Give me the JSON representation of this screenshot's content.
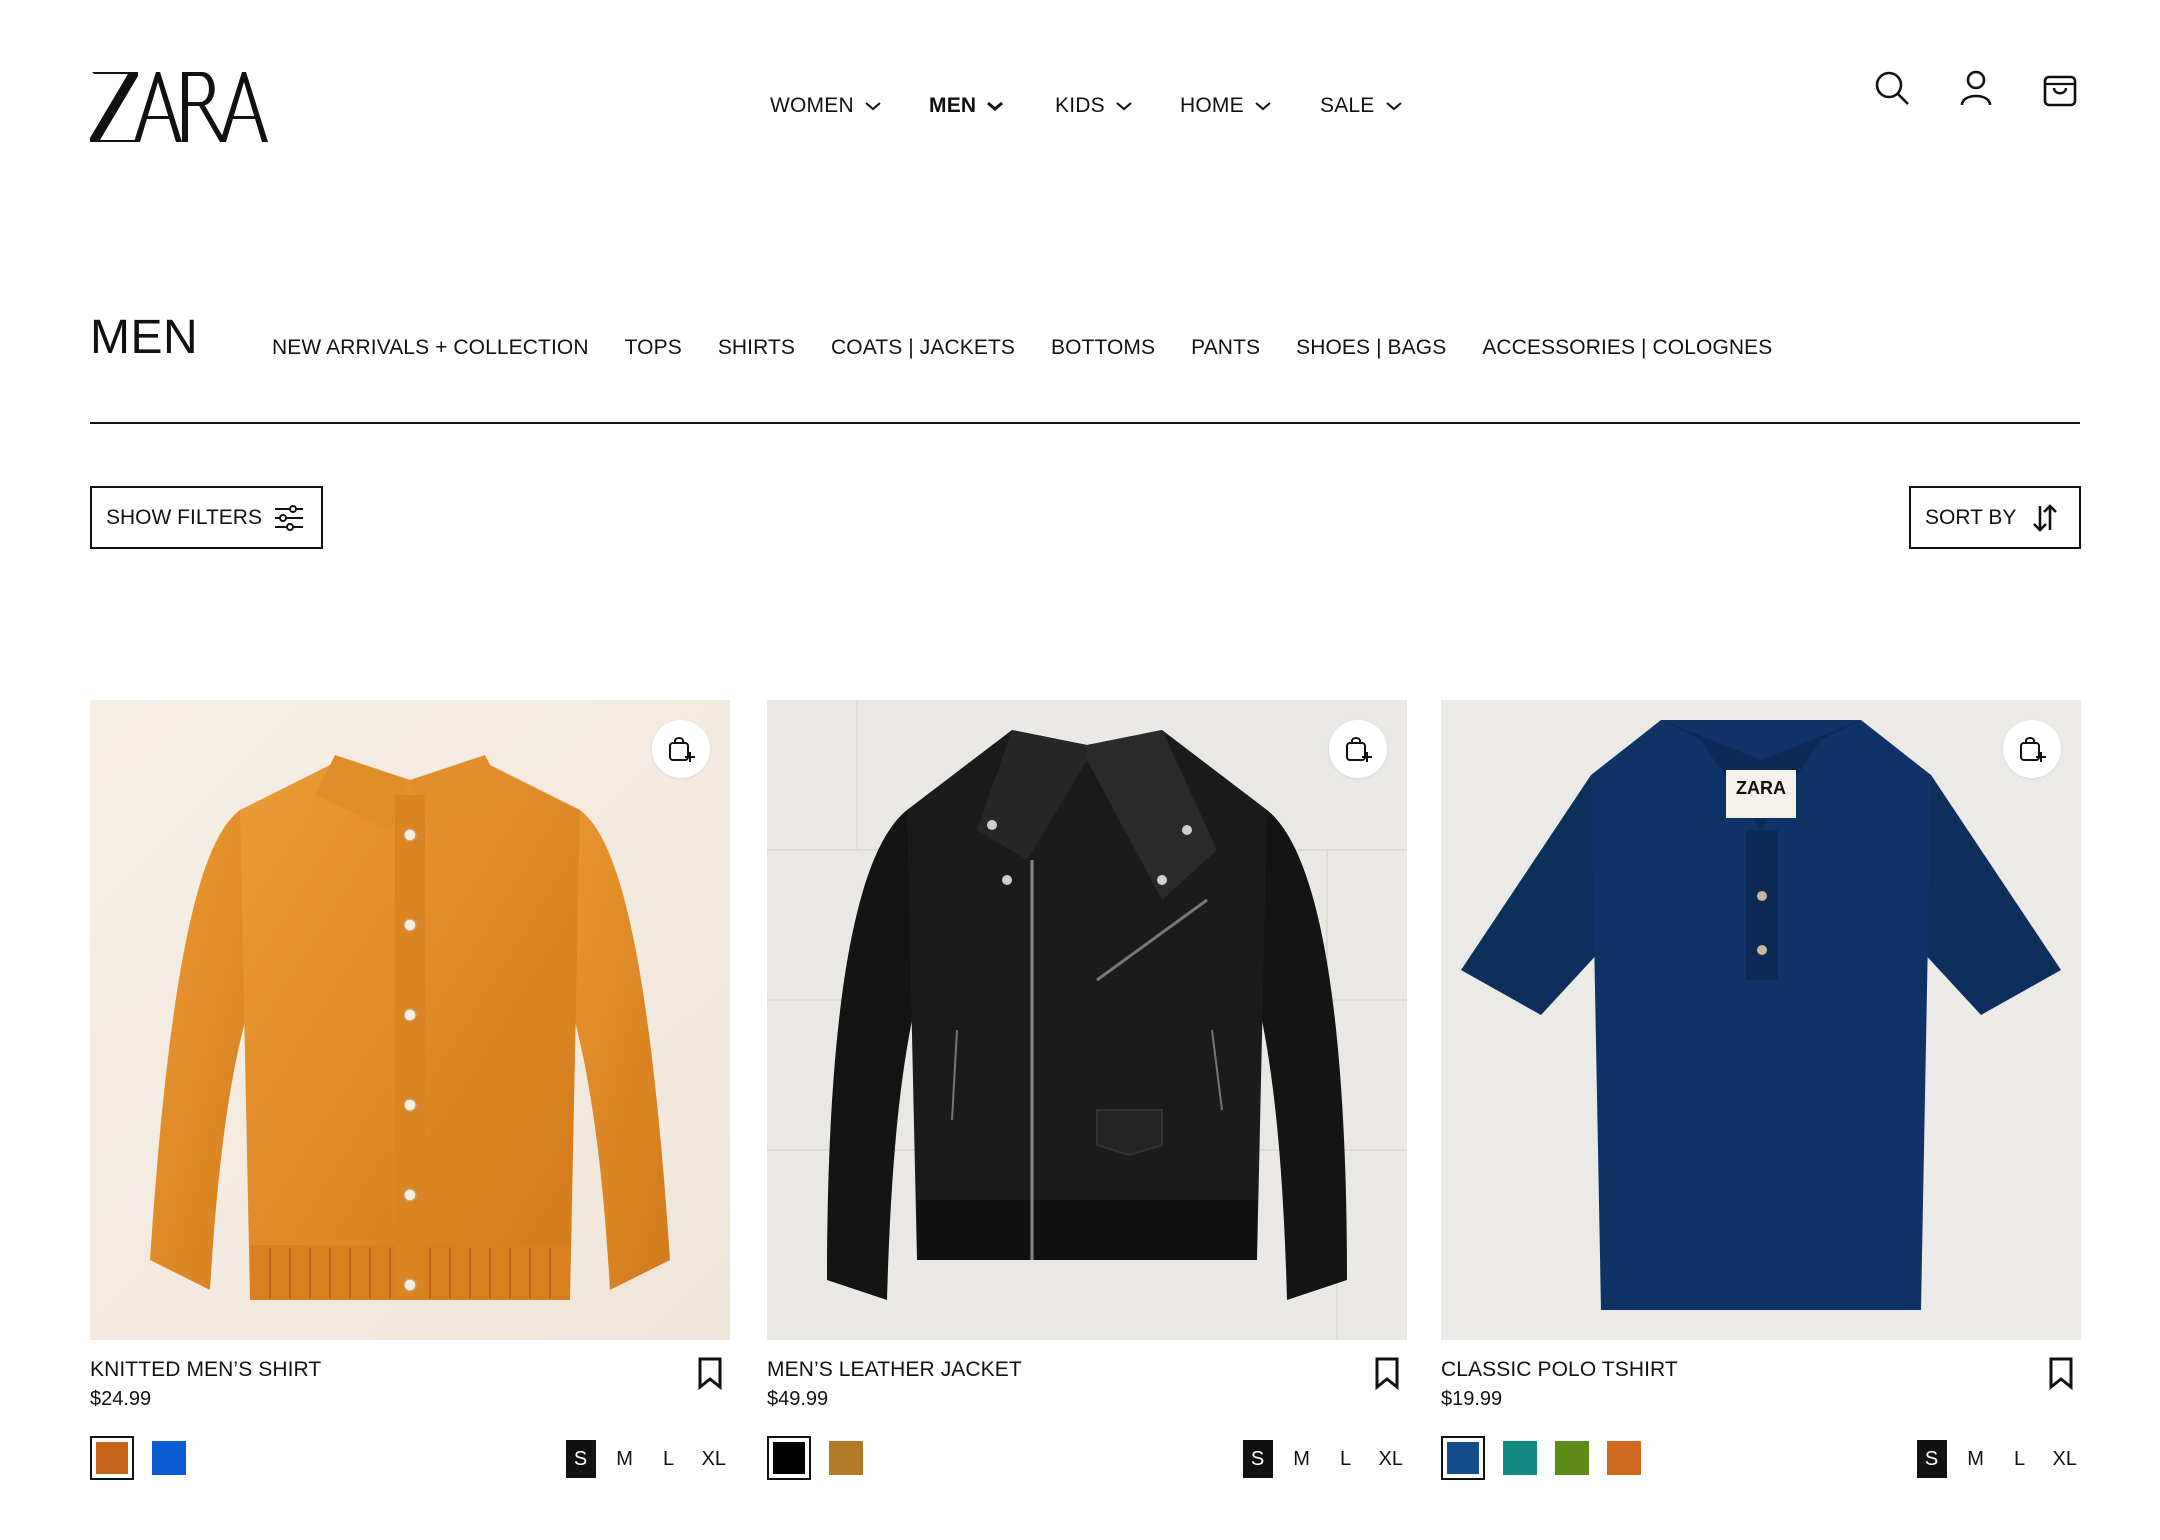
{
  "brand": {
    "logo_text": "ZARA"
  },
  "main_nav": [
    {
      "label": "WOMEN",
      "active": false
    },
    {
      "label": "MEN",
      "active": true
    },
    {
      "label": "KIDS",
      "active": false
    },
    {
      "label": "HOME",
      "active": false
    },
    {
      "label": "SALE",
      "active": false
    }
  ],
  "header_icons": [
    "search-icon",
    "user-icon",
    "shopping-bag-icon"
  ],
  "page": {
    "title": "MEN"
  },
  "sub_nav": [
    "NEW ARRIVALS + COLLECTION",
    "TOPS",
    "SHIRTS",
    "COATS | JACKETS",
    "BOTTOMS",
    "PANTS",
    "SHOES | BAGS",
    "ACCESSORIES | COLOGNES"
  ],
  "toolbar": {
    "filters_label": "SHOW FILTERS",
    "sort_label": "SORT BY"
  },
  "products": [
    {
      "name": "KNITTED MEN’S SHIRT",
      "price": "$24.99",
      "image_label": "orange-knit-shirt",
      "colors": [
        "#c8641a",
        "#0b5bd3"
      ],
      "selected_color": 0,
      "sizes": [
        "S",
        "M",
        "L",
        "XL"
      ],
      "selected_size": "S"
    },
    {
      "name": "MEN’S LEATHER JACKET",
      "price": "$49.99",
      "image_label": "black-leather-jacket",
      "colors": [
        "#000000",
        "#b07a26"
      ],
      "selected_color": 0,
      "sizes": [
        "S",
        "M",
        "L",
        "XL"
      ],
      "selected_size": "S"
    },
    {
      "name": "CLASSIC POLO TSHIRT",
      "price": "$19.99",
      "image_label": "navy-polo-shirt",
      "label_text": "ZARA",
      "colors": [
        "#154c8c",
        "#138a84",
        "#5e8c1a",
        "#d06a20"
      ],
      "selected_color": 0,
      "sizes": [
        "S",
        "M",
        "L",
        "XL"
      ],
      "selected_size": "S"
    }
  ]
}
